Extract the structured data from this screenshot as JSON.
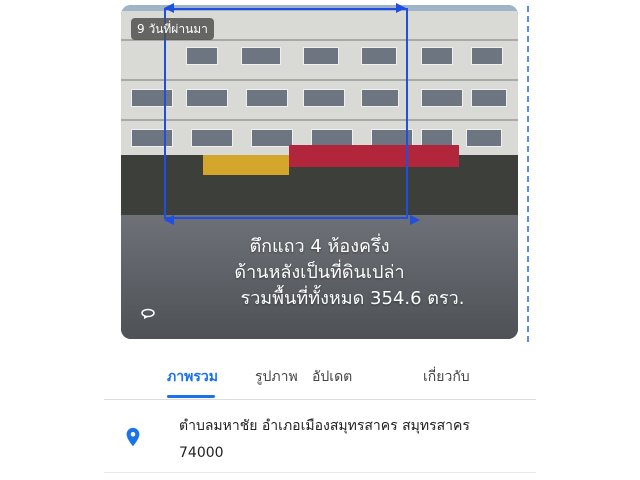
{
  "photo": {
    "age_badge": "9 วันที่ผ่านมา",
    "caption_lines": [
      "ตึกแถว 4 ห้องครึ่ง",
      "ด้านหลังเป็นที่ดินเปล่า",
      "รวมพื้นที่ทั้งหมด 354.6 ตรว."
    ],
    "annotation_color": "#1f4fe0"
  },
  "tabs": {
    "items": [
      {
        "label": "ภาพรวม",
        "active": true
      },
      {
        "label": "รูปภาพ",
        "active": false
      },
      {
        "label": "อัปเดต",
        "active": false
      },
      {
        "label": "เกี่ยวกับ",
        "active": false
      }
    ],
    "accent_color": "#1a73e8"
  },
  "address": {
    "icon": "location-pin-icon",
    "line1": "ตำบลมหาชัย อำเภอเมืองสมุทรสาคร สมุทรสาคร",
    "line2": "74000"
  }
}
